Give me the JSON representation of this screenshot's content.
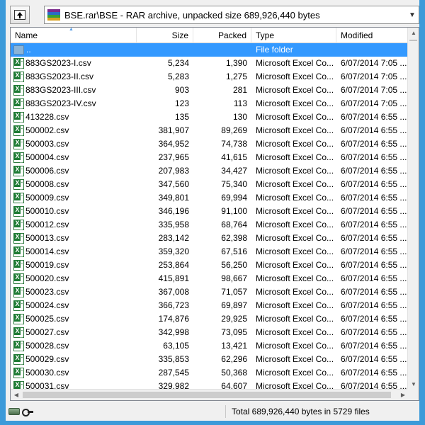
{
  "window": {
    "frame_color": "#3c9ad9"
  },
  "address": {
    "path": "BSE.rar\\BSE - RAR archive, unpacked size 689,926,440 bytes"
  },
  "columns": {
    "name": "Name",
    "size": "Size",
    "packed": "Packed",
    "type": "Type",
    "modified": "Modified"
  },
  "rows": [
    {
      "name": "..",
      "size": "",
      "packed": "",
      "type": "File folder",
      "modified": "",
      "icon": "folder-icon",
      "selected": true
    },
    {
      "name": "883GS2023-I.csv",
      "size": "5,234",
      "packed": "1,390",
      "type": "Microsoft Excel Co...",
      "modified": "6/07/2014 7:05 ...",
      "icon": "excel-icon"
    },
    {
      "name": "883GS2023-II.csv",
      "size": "5,283",
      "packed": "1,275",
      "type": "Microsoft Excel Co...",
      "modified": "6/07/2014 7:05 ...",
      "icon": "excel-icon"
    },
    {
      "name": "883GS2023-III.csv",
      "size": "903",
      "packed": "281",
      "type": "Microsoft Excel Co...",
      "modified": "6/07/2014 7:05 ...",
      "icon": "excel-icon"
    },
    {
      "name": "883GS2023-IV.csv",
      "size": "123",
      "packed": "113",
      "type": "Microsoft Excel Co...",
      "modified": "6/07/2014 7:05 ...",
      "icon": "excel-icon"
    },
    {
      "name": "413228.csv",
      "size": "135",
      "packed": "130",
      "type": "Microsoft Excel Co...",
      "modified": "6/07/2014 6:55 ...",
      "icon": "excel-icon"
    },
    {
      "name": "500002.csv",
      "size": "381,907",
      "packed": "89,269",
      "type": "Microsoft Excel Co...",
      "modified": "6/07/2014 6:55 ...",
      "icon": "excel-icon"
    },
    {
      "name": "500003.csv",
      "size": "364,952",
      "packed": "74,738",
      "type": "Microsoft Excel Co...",
      "modified": "6/07/2014 6:55 ...",
      "icon": "excel-icon"
    },
    {
      "name": "500004.csv",
      "size": "237,965",
      "packed": "41,615",
      "type": "Microsoft Excel Co...",
      "modified": "6/07/2014 6:55 ...",
      "icon": "excel-icon"
    },
    {
      "name": "500006.csv",
      "size": "207,983",
      "packed": "34,427",
      "type": "Microsoft Excel Co...",
      "modified": "6/07/2014 6:55 ...",
      "icon": "excel-icon"
    },
    {
      "name": "500008.csv",
      "size": "347,560",
      "packed": "75,340",
      "type": "Microsoft Excel Co...",
      "modified": "6/07/2014 6:55 ...",
      "icon": "excel-icon"
    },
    {
      "name": "500009.csv",
      "size": "349,801",
      "packed": "69,994",
      "type": "Microsoft Excel Co...",
      "modified": "6/07/2014 6:55 ...",
      "icon": "excel-icon"
    },
    {
      "name": "500010.csv",
      "size": "346,196",
      "packed": "91,100",
      "type": "Microsoft Excel Co...",
      "modified": "6/07/2014 6:55 ...",
      "icon": "excel-icon"
    },
    {
      "name": "500012.csv",
      "size": "335,958",
      "packed": "68,764",
      "type": "Microsoft Excel Co...",
      "modified": "6/07/2014 6:55 ...",
      "icon": "excel-icon"
    },
    {
      "name": "500013.csv",
      "size": "283,142",
      "packed": "62,398",
      "type": "Microsoft Excel Co...",
      "modified": "6/07/2014 6:55 ...",
      "icon": "excel-icon"
    },
    {
      "name": "500014.csv",
      "size": "359,320",
      "packed": "67,516",
      "type": "Microsoft Excel Co...",
      "modified": "6/07/2014 6:55 ...",
      "icon": "excel-icon"
    },
    {
      "name": "500019.csv",
      "size": "253,864",
      "packed": "56,250",
      "type": "Microsoft Excel Co...",
      "modified": "6/07/2014 6:55 ...",
      "icon": "excel-icon"
    },
    {
      "name": "500020.csv",
      "size": "415,891",
      "packed": "98,667",
      "type": "Microsoft Excel Co...",
      "modified": "6/07/2014 6:55 ...",
      "icon": "excel-icon"
    },
    {
      "name": "500023.csv",
      "size": "367,008",
      "packed": "71,057",
      "type": "Microsoft Excel Co...",
      "modified": "6/07/2014 6:55 ...",
      "icon": "excel-icon"
    },
    {
      "name": "500024.csv",
      "size": "366,723",
      "packed": "69,897",
      "type": "Microsoft Excel Co...",
      "modified": "6/07/2014 6:55 ...",
      "icon": "excel-icon"
    },
    {
      "name": "500025.csv",
      "size": "174,876",
      "packed": "29,925",
      "type": "Microsoft Excel Co...",
      "modified": "6/07/2014 6:55 ...",
      "icon": "excel-icon"
    },
    {
      "name": "500027.csv",
      "size": "342,998",
      "packed": "73,095",
      "type": "Microsoft Excel Co...",
      "modified": "6/07/2014 6:55 ...",
      "icon": "excel-icon"
    },
    {
      "name": "500028.csv",
      "size": "63,105",
      "packed": "13,421",
      "type": "Microsoft Excel Co...",
      "modified": "6/07/2014 6:55 ...",
      "icon": "excel-icon"
    },
    {
      "name": "500029.csv",
      "size": "335,853",
      "packed": "62,296",
      "type": "Microsoft Excel Co...",
      "modified": "6/07/2014 6:55 ...",
      "icon": "excel-icon"
    },
    {
      "name": "500030.csv",
      "size": "287,545",
      "packed": "50,368",
      "type": "Microsoft Excel Co...",
      "modified": "6/07/2014 6:55 ...",
      "icon": "excel-icon"
    },
    {
      "name": "500031.csv",
      "size": "329,982",
      "packed": "64,607",
      "type": "Microsoft Excel Co...",
      "modified": "6/07/2014 6:55 ...",
      "icon": "excel-icon"
    }
  ],
  "status": {
    "text": "Total 689,926,440 bytes in 5729 files"
  }
}
